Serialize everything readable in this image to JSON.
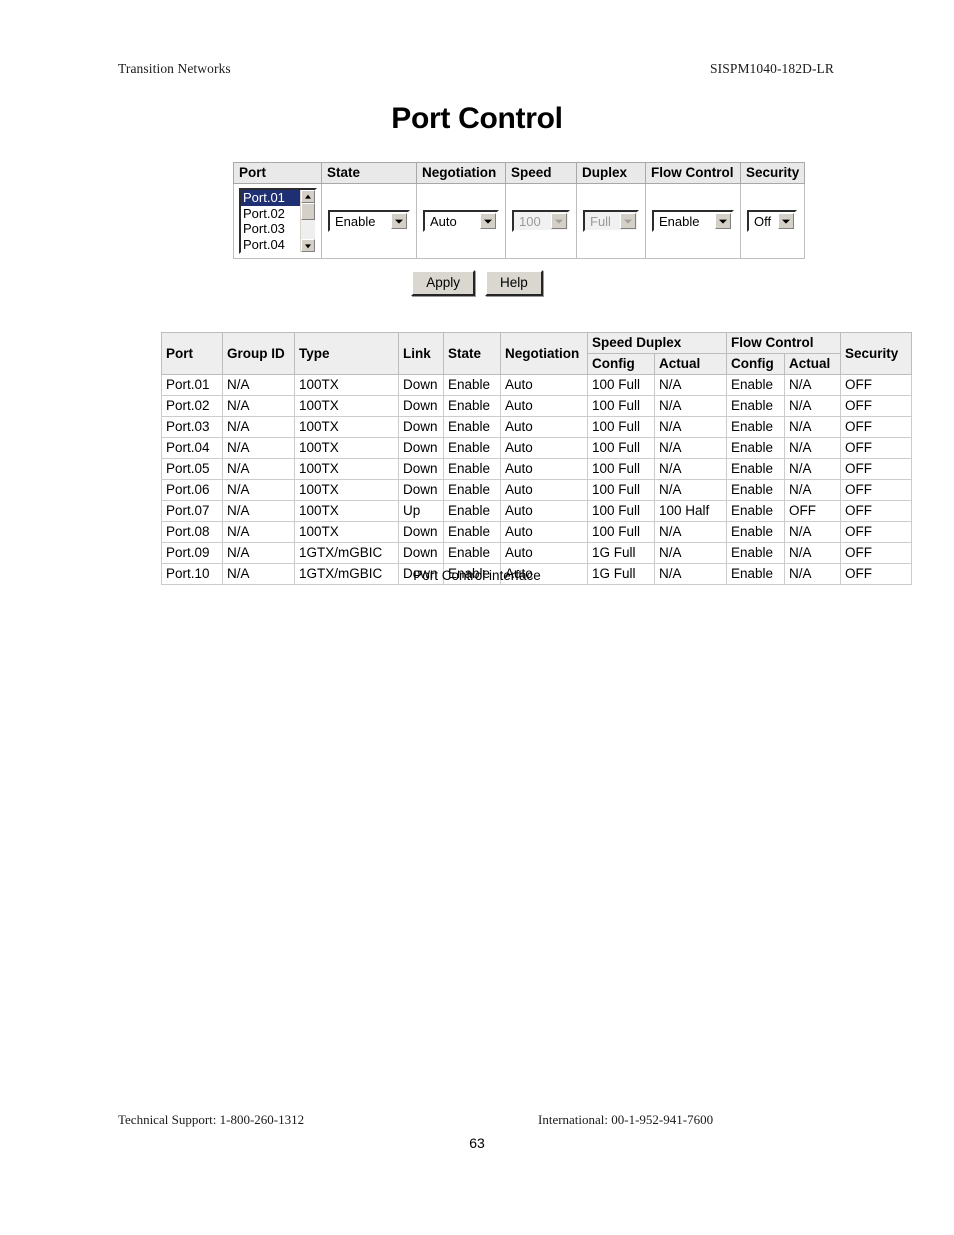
{
  "header": {
    "left": "Transition Networks",
    "right": "SISPM1040-182D-LR"
  },
  "title": "Port Control",
  "form": {
    "headers": [
      "Port",
      "State",
      "Negotiation",
      "Speed",
      "Duplex",
      "Flow Control",
      "Security"
    ],
    "port_list": {
      "options": [
        "Port.01",
        "Port.02",
        "Port.03",
        "Port.04"
      ],
      "selected": "Port.01"
    },
    "state": {
      "value": "Enable",
      "disabled": false
    },
    "negotiation": {
      "value": "Auto",
      "disabled": false
    },
    "speed": {
      "value": "100",
      "disabled": true
    },
    "duplex": {
      "value": "Full",
      "disabled": true
    },
    "flow_control": {
      "value": "Enable",
      "disabled": false
    },
    "security": {
      "value": "Off",
      "disabled": false
    }
  },
  "buttons": {
    "apply": "Apply",
    "help": "Help"
  },
  "status_table": {
    "headers": {
      "port": "Port",
      "group_id": "Group ID",
      "type": "Type",
      "link": "Link",
      "state": "State",
      "negotiation": "Negotiation",
      "speed_duplex": "Speed Duplex",
      "flow_control": "Flow Control",
      "security": "Security",
      "config": "Config",
      "actual": "Actual",
      "fc_config": "Config",
      "fc_actual": "Actual"
    },
    "rows": [
      {
        "port": "Port.01",
        "group_id": "N/A",
        "type": "100TX",
        "link": "Down",
        "state": "Enable",
        "negotiation": "Auto",
        "speed_config": "100 Full",
        "speed_actual": "N/A",
        "fc_config": "Enable",
        "fc_actual": "N/A",
        "security": "OFF"
      },
      {
        "port": "Port.02",
        "group_id": "N/A",
        "type": "100TX",
        "link": "Down",
        "state": "Enable",
        "negotiation": "Auto",
        "speed_config": "100 Full",
        "speed_actual": "N/A",
        "fc_config": "Enable",
        "fc_actual": "N/A",
        "security": "OFF"
      },
      {
        "port": "Port.03",
        "group_id": "N/A",
        "type": "100TX",
        "link": "Down",
        "state": "Enable",
        "negotiation": "Auto",
        "speed_config": "100 Full",
        "speed_actual": "N/A",
        "fc_config": "Enable",
        "fc_actual": "N/A",
        "security": "OFF"
      },
      {
        "port": "Port.04",
        "group_id": "N/A",
        "type": "100TX",
        "link": "Down",
        "state": "Enable",
        "negotiation": "Auto",
        "speed_config": "100 Full",
        "speed_actual": "N/A",
        "fc_config": "Enable",
        "fc_actual": "N/A",
        "security": "OFF"
      },
      {
        "port": "Port.05",
        "group_id": "N/A",
        "type": "100TX",
        "link": "Down",
        "state": "Enable",
        "negotiation": "Auto",
        "speed_config": "100 Full",
        "speed_actual": "N/A",
        "fc_config": "Enable",
        "fc_actual": "N/A",
        "security": "OFF"
      },
      {
        "port": "Port.06",
        "group_id": "N/A",
        "type": "100TX",
        "link": "Down",
        "state": "Enable",
        "negotiation": "Auto",
        "speed_config": "100 Full",
        "speed_actual": "N/A",
        "fc_config": "Enable",
        "fc_actual": "N/A",
        "security": "OFF"
      },
      {
        "port": "Port.07",
        "group_id": "N/A",
        "type": "100TX",
        "link": "Up",
        "state": "Enable",
        "negotiation": "Auto",
        "speed_config": "100 Full",
        "speed_actual": "100 Half",
        "fc_config": "Enable",
        "fc_actual": "OFF",
        "security": "OFF"
      },
      {
        "port": "Port.08",
        "group_id": "N/A",
        "type": "100TX",
        "link": "Down",
        "state": "Enable",
        "negotiation": "Auto",
        "speed_config": "100 Full",
        "speed_actual": "N/A",
        "fc_config": "Enable",
        "fc_actual": "N/A",
        "security": "OFF"
      },
      {
        "port": "Port.09",
        "group_id": "N/A",
        "type": "1GTX/mGBIC",
        "link": "Down",
        "state": "Enable",
        "negotiation": "Auto",
        "speed_config": "1G Full",
        "speed_actual": "N/A",
        "fc_config": "Enable",
        "fc_actual": "N/A",
        "security": "OFF"
      },
      {
        "port": "Port.10",
        "group_id": "N/A",
        "type": "1GTX/mGBIC",
        "link": "Down",
        "state": "Enable",
        "negotiation": "Auto",
        "speed_config": "1G Full",
        "speed_actual": "N/A",
        "fc_config": "Enable",
        "fc_actual": "N/A",
        "security": "OFF"
      }
    ]
  },
  "caption": "Port Control interface",
  "footer": {
    "technical_support": "Technical Support: 1-800-260-1312",
    "international": "International: 00-1-952-941-7600",
    "page_number": "63"
  }
}
